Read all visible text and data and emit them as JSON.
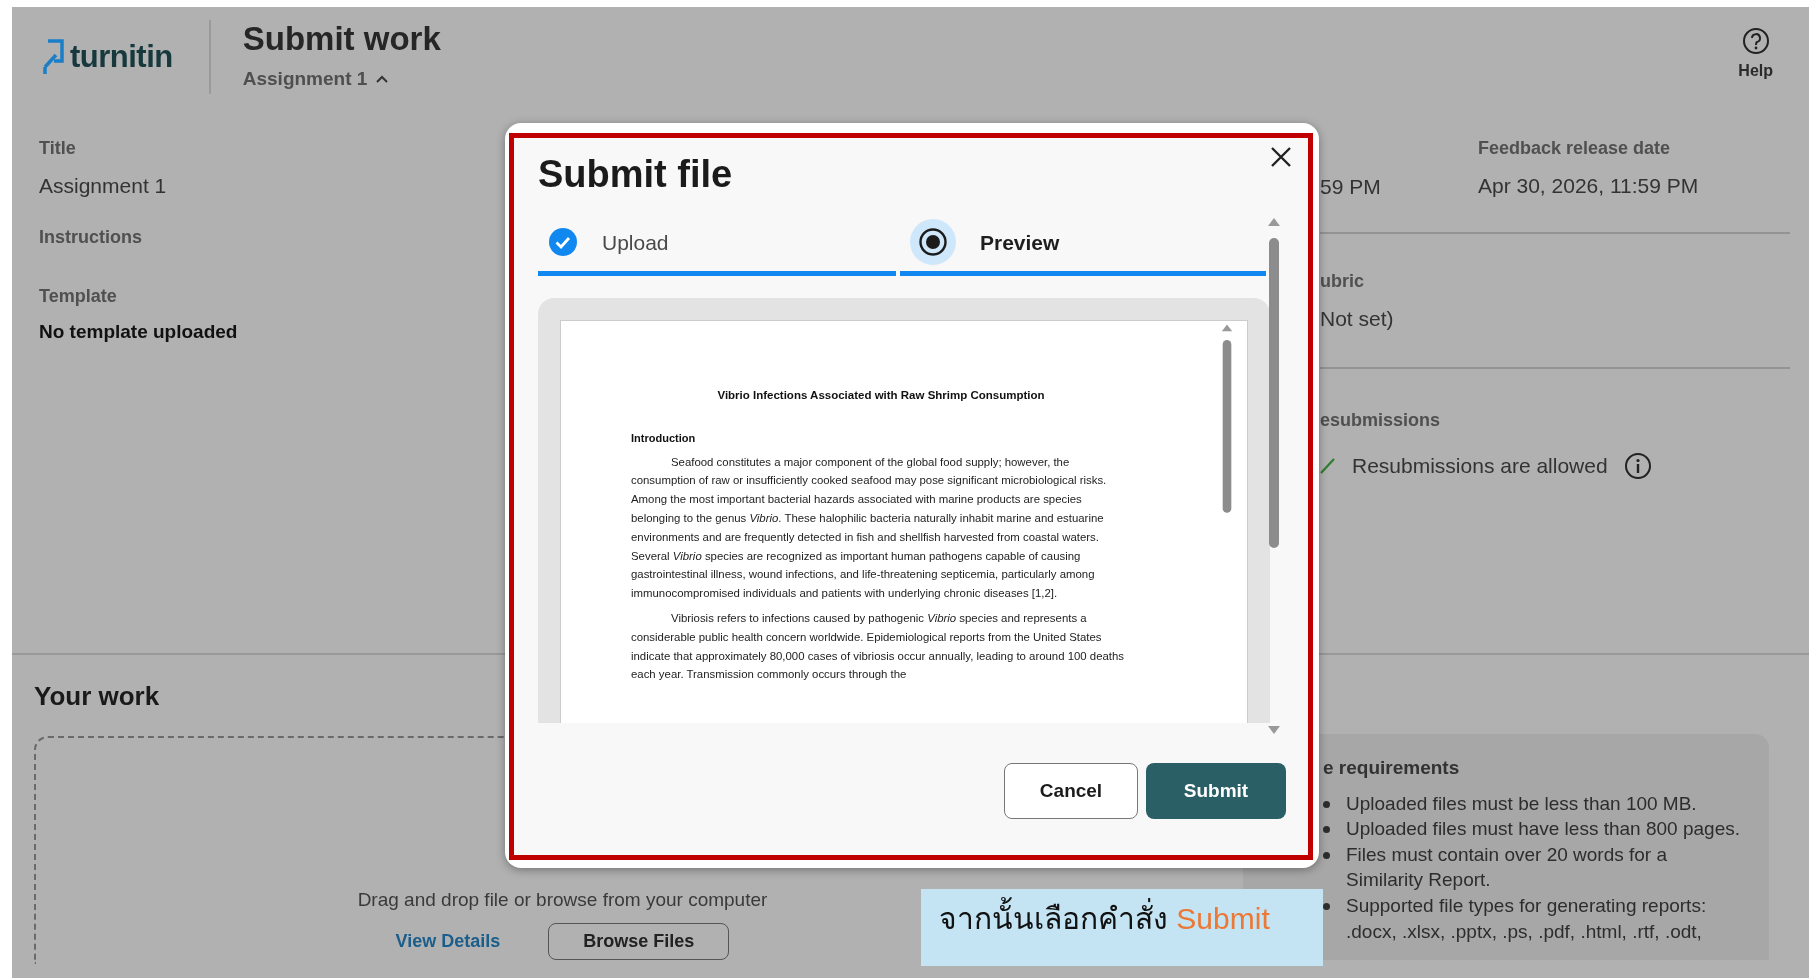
{
  "app": {
    "logo": "turnitin",
    "title": "Submit work",
    "assignment_menu": {
      "label": "Assignment 1",
      "expanded": true
    },
    "help": "Help"
  },
  "details_left": [
    {
      "label": "Title",
      "value": "Assignment 1",
      "emphasis": false
    },
    {
      "label": "Instructions"
    },
    {
      "label": "Template",
      "value": "No template uploaded",
      "emphasis": true
    }
  ],
  "details_right": {
    "due_value": "59 PM",
    "feedback": {
      "label": "Feedback release date",
      "value": "Apr 30, 2026, 11:59 PM"
    },
    "rubric": {
      "label": "ubric",
      "value": "Not set)"
    },
    "resubmissions": {
      "label": "esubmissions",
      "value": "Resubmissions are allowed",
      "allowed": true
    }
  },
  "your_work": {
    "heading": "Your work",
    "dropzone": {
      "prompt": "Drag and drop file or browse from your computer",
      "link": "View Details",
      "button": "Browse Files"
    },
    "requirements": {
      "heading": "e requirements",
      "items": [
        "Uploaded files must be less than 100 MB.",
        "Uploaded files must have less than 800 pages.",
        "Files must contain over 20 words for a Similarity Report.",
        "Supported file types for generating reports: .docx, .xlsx, .pptx, .ps, .pdf, .html, .rtf, .odt,"
      ]
    }
  },
  "modal": {
    "title": "Submit file",
    "steps": [
      {
        "label": "Upload",
        "completed": true,
        "selected": false
      },
      {
        "label": "Preview",
        "completed": false,
        "selected": true
      }
    ],
    "document": {
      "title": "Vibrio Infections Associated with Raw Shrimp Consumption",
      "heading": "Introduction",
      "paragraphs": [
        "Seafood constitutes a major component of the global food supply; however, the consumption of raw or insufficiently cooked seafood may pose significant microbiological risks. Among the most important bacterial hazards associated with marine products are species belonging to the genus *Vibrio*. These halophilic bacteria naturally inhabit marine and estuarine environments and are frequently detected in fish and shellfish harvested from coastal waters. Several *Vibrio* species are recognized as important human pathogens capable of causing gastrointestinal illness, wound infections, and life-threatening septicemia, particularly among immunocompromised individuals and patients with underlying chronic diseases [1,2].",
        "Vibriosis refers to infections caused by pathogenic *Vibrio* species and represents a considerable public health concern worldwide. Epidemiological reports from the United States indicate that approximately 80,000 cases of vibriosis occur annually, leading to around 100 deaths each year. Transmission commonly occurs through the"
      ]
    },
    "buttons": [
      {
        "label": "Cancel",
        "kind": "secondary"
      },
      {
        "label": "Submit",
        "kind": "primary"
      }
    ]
  },
  "caption": {
    "text": "จากนั้นเลือกคำสั่ง",
    "highlight": "Submit"
  }
}
